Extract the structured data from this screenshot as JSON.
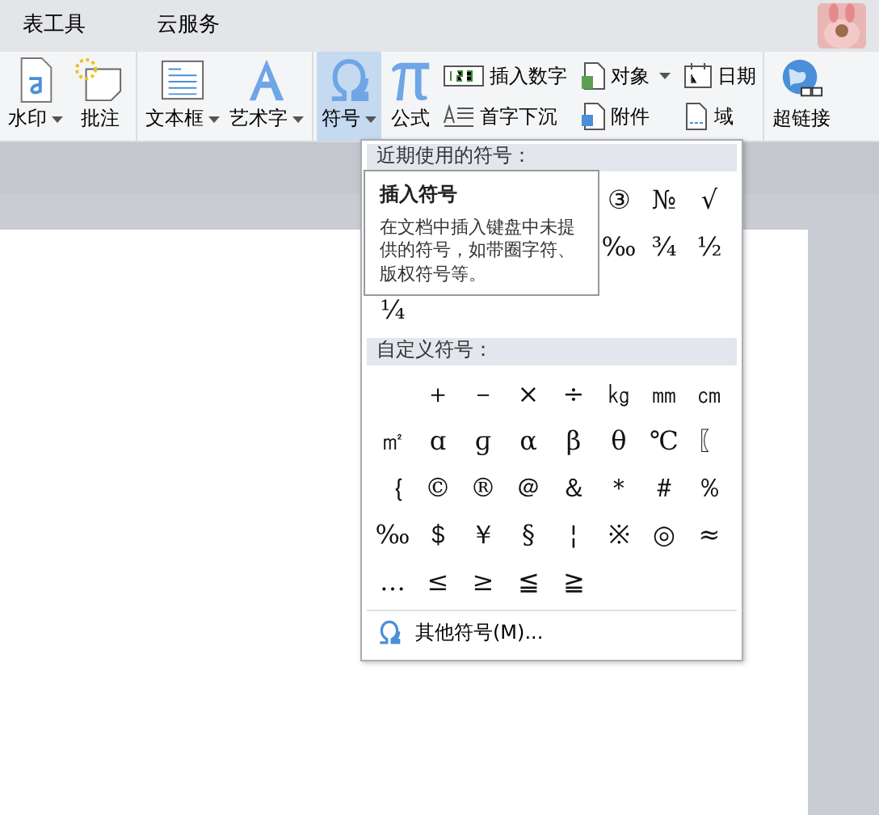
{
  "tabs": [
    {
      "label": "表工具",
      "selected": false
    },
    {
      "label": "云服务",
      "selected": false
    }
  ],
  "ribbon": {
    "groups": [
      [
        {
          "label": "水印",
          "kind": "large",
          "dropdown": true,
          "selected": false
        },
        {
          "label": "批注",
          "kind": "large",
          "dropdown": false,
          "selected": false
        }
      ],
      [
        {
          "label": "文本框",
          "kind": "large",
          "dropdown": true,
          "selected": false
        },
        {
          "label": "艺术字",
          "kind": "large",
          "dropdown": true,
          "selected": false
        }
      ],
      [
        {
          "label": "符号",
          "kind": "large",
          "dropdown": true,
          "selected": true
        },
        {
          "label": "公式",
          "kind": "large",
          "dropdown": false,
          "selected": false
        },
        {
          "label": "插入数字",
          "kind": "small",
          "dropdown": false,
          "selected": false
        },
        {
          "label": "首字下沉",
          "kind": "small",
          "dropdown": false,
          "selected": false
        },
        {
          "label": "对象",
          "kind": "small",
          "dropdown": true,
          "selected": false
        },
        {
          "label": "附件",
          "kind": "small",
          "dropdown": false,
          "selected": false
        },
        {
          "label": "日期",
          "kind": "small",
          "dropdown": false,
          "selected": false
        },
        {
          "label": "域",
          "kind": "small",
          "dropdown": false,
          "selected": false
        }
      ],
      [
        {
          "label": "超链接",
          "kind": "large",
          "dropdown": false,
          "selected": false
        }
      ]
    ]
  },
  "symbol_menu": {
    "recent_header": "近期使用的符号：",
    "recent_rows": [
      [
        "③",
        "№",
        "√"
      ],
      [
        "‰",
        "¾",
        "½"
      ],
      [
        "¼"
      ]
    ],
    "custom_header": "自定义符号：",
    "custom": [
      "＋",
      "－",
      "×",
      "÷",
      "㎏",
      "㎜",
      "㎝",
      "㎡",
      "ɑ",
      "ɡ",
      "α",
      "β",
      "θ",
      "℃",
      "〖",
      "｛",
      "©",
      "®",
      "＠",
      "＆",
      "＊",
      "＃",
      "％",
      "‰",
      "＄",
      "￥",
      "§",
      "¦",
      "※",
      "◎",
      "≈",
      "…",
      "≤",
      "≥",
      "≦",
      "≧"
    ],
    "more": "其他符号(M)..."
  },
  "tooltip": {
    "title": "插入符号",
    "text": "在文档中插入键盘中未提供的符号，如带圈字符、版权符号等。"
  }
}
